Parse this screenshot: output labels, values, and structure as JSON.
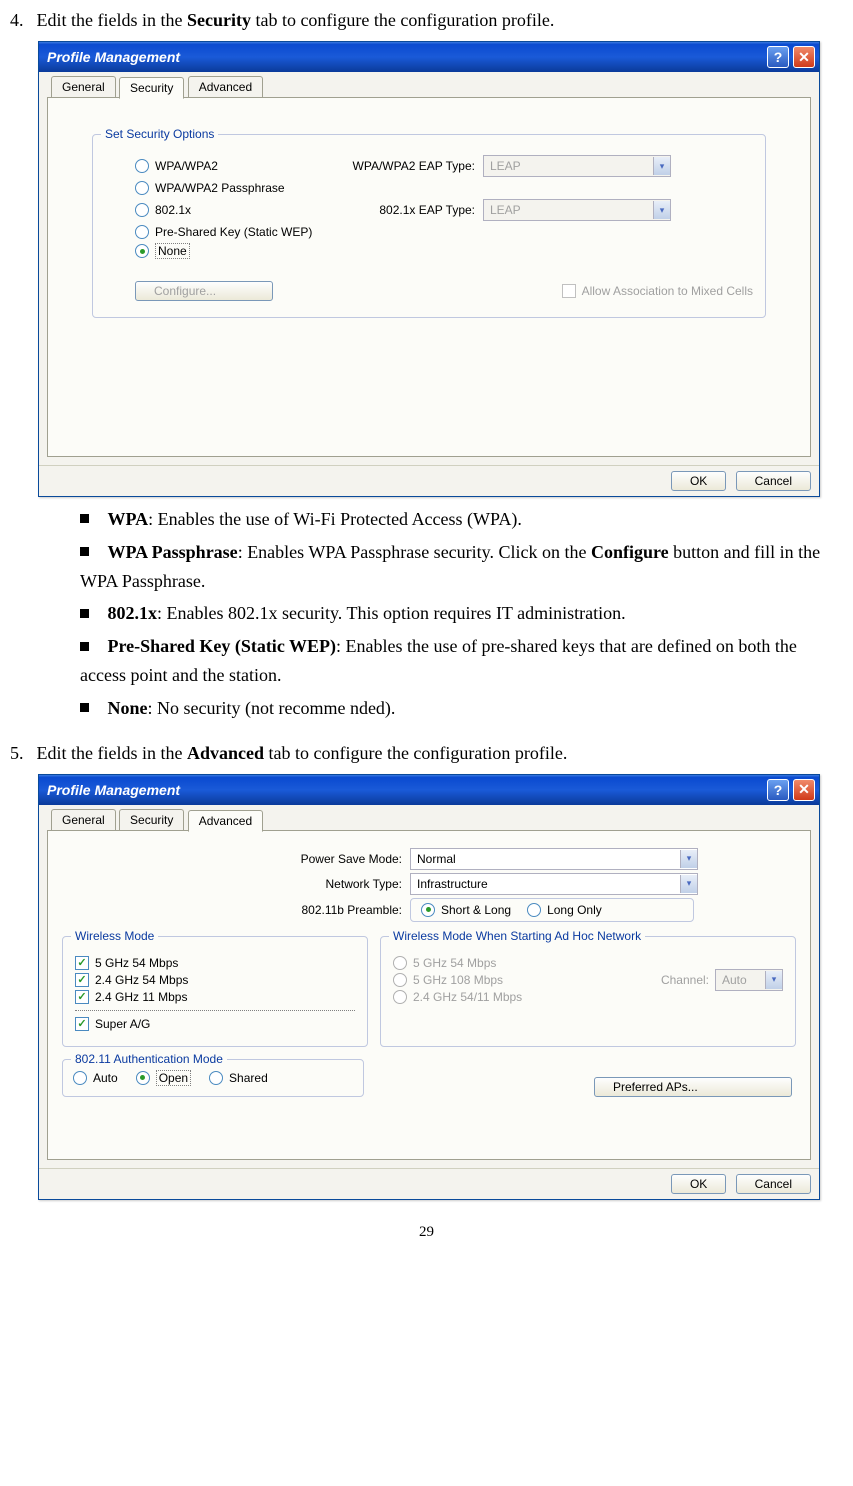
{
  "step4": {
    "num": "4.",
    "text_pre": "Edit the fields in the ",
    "text_bold": "Security",
    "text_post": " tab to configure the configuration profile."
  },
  "step5": {
    "num": "5.",
    "text_pre": "Edit the fields in the ",
    "text_bold": "Advanced",
    "text_post": " tab to configure the configuration profile."
  },
  "dlg1": {
    "title": "Profile Management",
    "tabs": {
      "general": "General",
      "security": "Security",
      "advanced": "Advanced"
    },
    "group_title": "Set Security Options",
    "r1": "WPA/WPA2",
    "r2": "WPA/WPA2 Passphrase",
    "r3": "802.1x",
    "r4": "Pre-Shared Key (Static WEP)",
    "r5": "None",
    "eap1_label": "WPA/WPA2 EAP Type:",
    "eap2_label": "802.1x EAP Type:",
    "eap_value": "LEAP",
    "configure": "Configure...",
    "allow_mixed": "Allow Association to Mixed Cells",
    "ok": "OK",
    "cancel": "Cancel"
  },
  "dlg2": {
    "title": "Profile Management",
    "tabs": {
      "general": "General",
      "security": "Security",
      "advanced": "Advanced"
    },
    "psm_label": "Power Save Mode:",
    "psm_value": "Normal",
    "nt_label": "Network Type:",
    "nt_value": "Infrastructure",
    "preamble_label": "802.11b Preamble:",
    "preamble_r1": "Short & Long",
    "preamble_r2": "Long Only",
    "wm_title": "Wireless Mode",
    "wm_c1": "5 GHz 54 Mbps",
    "wm_c2": "2.4 GHz 54 Mbps",
    "wm_c3": "2.4 GHz 11 Mbps",
    "wm_c4": "Super A/G",
    "adhoc_title": "Wireless Mode When Starting Ad Hoc Network",
    "ah_r1": "5 GHz 54 Mbps",
    "ah_r2": "5 GHz 108 Mbps",
    "ah_r3": "2.4 GHz 54/11 Mbps",
    "channel_label": "Channel:",
    "channel_value": "Auto",
    "auth_title": "802.11 Authentication Mode",
    "auth_r1": "Auto",
    "auth_r2": "Open",
    "auth_r3": "Shared",
    "preferred": "Preferred APs...",
    "ok": "OK",
    "cancel": "Cancel"
  },
  "bullets": {
    "b1_bold": "WPA",
    "b1_rest": ": Enables the use of Wi-Fi Protected Access (WPA).",
    "b2_bold": "WPA Passphrase",
    "b2_rest": ": Enables WPA Passphrase security. Click on the ",
    "b2_bold2": "Configure",
    "b2_rest2": " button and fill in the WPA Passphrase.",
    "b3_bold": "802.1x",
    "b3_rest": ": Enables 802.1x security. This option requires IT administration.",
    "b4_bold": "Pre-Shared Key (Static WEP)",
    "b4_rest": ": Enables the use of pre-shared keys that are defined on both the access point and the station.",
    "b5_bold": "None",
    "b5_rest": ": No security (not recomme nded)."
  },
  "pagenum": "29"
}
